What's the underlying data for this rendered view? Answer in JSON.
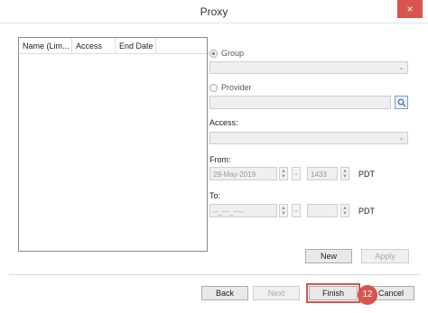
{
  "window": {
    "title": "Proxy",
    "close_glyph": "×"
  },
  "table": {
    "columns": [
      "Name (Lim...",
      "Access",
      "End Date"
    ]
  },
  "group": {
    "label": "Group",
    "selected": true
  },
  "provider": {
    "label": "Provider",
    "selected": false
  },
  "access": {
    "label": "Access:"
  },
  "from": {
    "label": "From:",
    "date": "29-May-2019",
    "time": "1433",
    "tz": "PDT"
  },
  "to": {
    "label": "To:",
    "date": "--_---_----",
    "time": "",
    "tz": "PDT"
  },
  "buttons": {
    "new": "New",
    "apply": "Apply",
    "back": "Back",
    "next": "Next",
    "finish": "Finish",
    "cancel": "Cancel"
  },
  "step_badge": "12",
  "icons": {
    "search": "search-icon",
    "close": "close-icon",
    "spin": "spin-icon",
    "dropdown": "chevron-down-icon"
  },
  "colors": {
    "highlight": "#d9534f",
    "close_bg": "#d9534f"
  }
}
